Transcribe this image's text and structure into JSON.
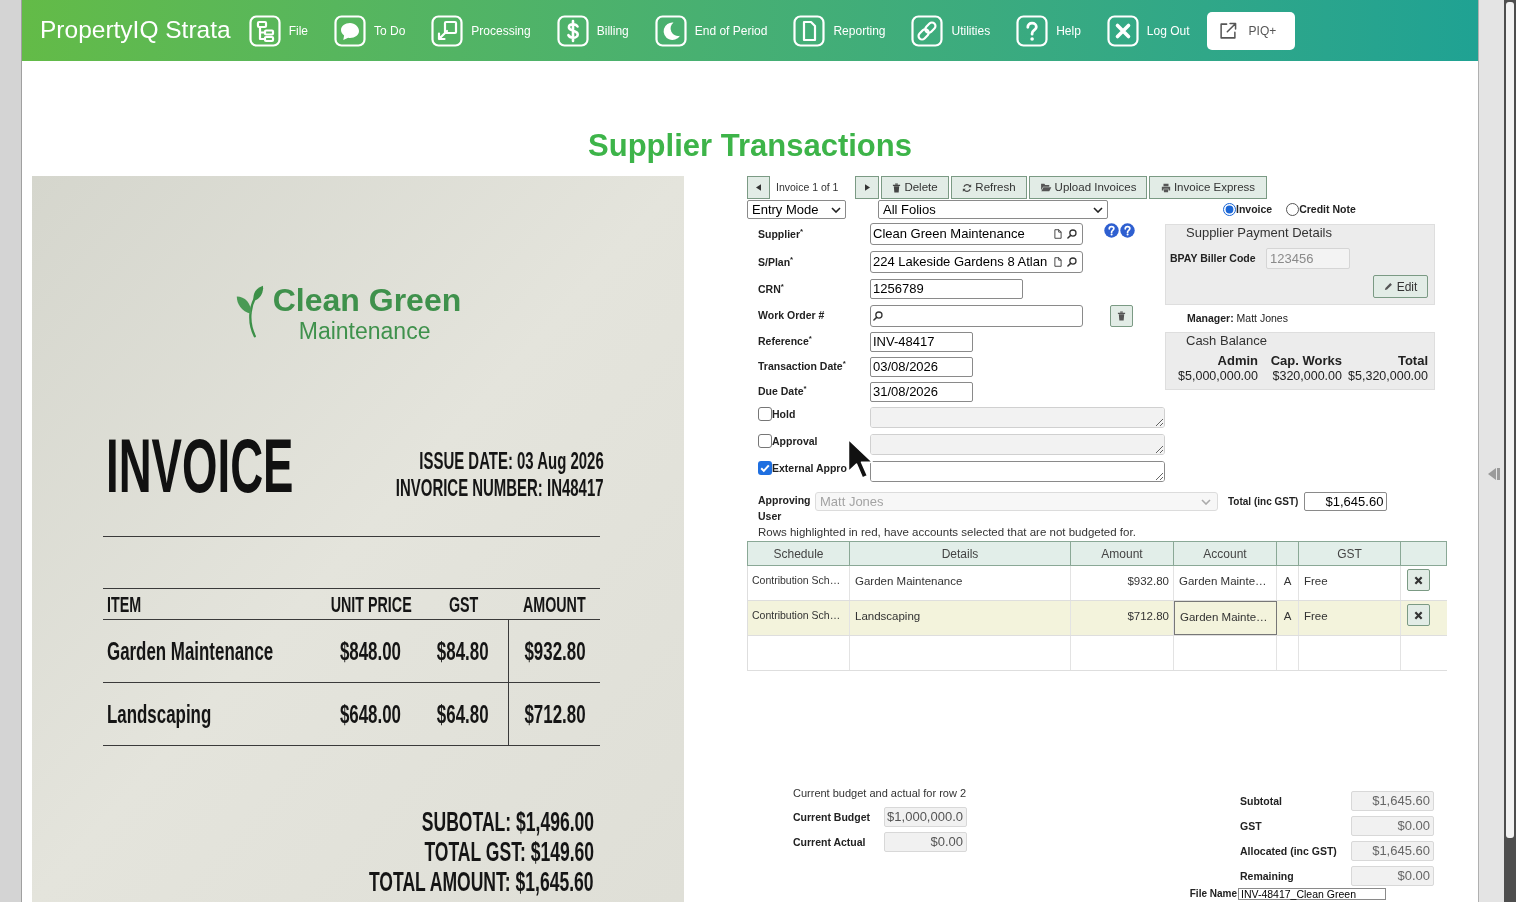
{
  "app_bar": {
    "logo": "PropertyIQ Strata",
    "menu": [
      {
        "label": "File",
        "kind": "file"
      },
      {
        "label": "To Do",
        "kind": "todo"
      },
      {
        "label": "Processing",
        "kind": "processing"
      },
      {
        "label": "Billing",
        "kind": "billing"
      },
      {
        "label": "End of Period",
        "kind": "period"
      },
      {
        "label": "Reporting",
        "kind": "reporting"
      },
      {
        "label": "Utilities",
        "kind": "utilities"
      },
      {
        "label": "Help",
        "kind": "help"
      },
      {
        "label": "Log Out",
        "kind": "logout"
      },
      {
        "label": "PIQ+",
        "kind": "external"
      }
    ]
  },
  "page": {
    "title": "Supplier Transactions"
  },
  "invoice_document": {
    "company": "Clean Green",
    "company_line_2": "Maintenance",
    "heading": "INVOICE",
    "issue_date": "ISSUE DATE: 03 Aug 2026",
    "invoice_number": "INVORICE NUMBER: IN48417",
    "columns": [
      "ITEM",
      "UNIT PRICE",
      "GST",
      "AMOUNT"
    ],
    "rows": [
      [
        "Garden Maintenance",
        "$848.00",
        "$84.80",
        "$932.80"
      ],
      [
        "Landscaping",
        "$648.00",
        "$64.80",
        "$712.80"
      ]
    ],
    "totals": [
      "SUBOTAL: $1,496.00",
      "TOTAL GST: $149.60",
      "TOTAL AMOUNT: $1,645.60"
    ]
  },
  "form": {
    "navigator": {
      "position": "Invoice 1 of 1"
    },
    "toolbar": [
      {
        "label": "Delete",
        "kind": "delete"
      },
      {
        "label": "Refresh",
        "kind": "refresh"
      },
      {
        "label": "Upload Invoices",
        "kind": "upload"
      },
      {
        "label": "Invoice Express",
        "kind": "print"
      }
    ],
    "mode_select": {
      "value": "Entry Mode"
    },
    "folio_select": {
      "value": "All Folios"
    },
    "transaction_type": [
      {
        "label": "Invoice",
        "selected": true
      },
      {
        "label": "Credit Note",
        "selected": false
      }
    ],
    "fields": [
      {
        "label": "Supplier$^{*}$",
        "value": "Clean Green Maintenance",
        "kind": "lookup",
        "help": true
      },
      {
        "label": "S/Plan$^{*}$",
        "value": "224 Lakeside Gardens 8 Atlan",
        "kind": "lookup"
      },
      {
        "label": "CRN$^{*}$",
        "value": "1256789",
        "kind": "number"
      },
      {
        "label": "Work Order #",
        "kind": "search",
        "clear_button": true
      },
      {
        "label": "Reference$^{*}$",
        "value": "INV-48417",
        "kind": "text"
      },
      {
        "label": "Transaction Date$^{*}$",
        "value": "03/08/2026",
        "kind": "date"
      },
      {
        "label": "Due Date$^{*}$",
        "value": "31/08/2026",
        "kind": "date"
      }
    ],
    "payment_details": {
      "legend": "Supplier Payment Details",
      "biller_code_label": "BPAY Biller Code",
      "biller_code": "123456",
      "edit_button": "Edit"
    },
    "manager": "**Manager:** Matt Jones",
    "cash_balance": {
      "legend": "Cash Balance",
      "columns": [
        "Admin",
        "Cap. Works",
        "Total"
      ],
      "values": [
        "$5,000,000.00",
        "$320,000.00",
        "$5,320,000.00"
      ]
    },
    "flags": [
      {
        "label": "Hold",
        "checked": false
      },
      {
        "label": "Approval",
        "checked": false
      },
      {
        "label": "External Appro",
        "checked": true
      }
    ],
    "approving_user": {
      "label": "Approving User",
      "value": "Matt Jones",
      "disabled": true
    },
    "total": {
      "label": "Total (inc GST)",
      "value": "$1,645.60"
    },
    "note": "Rows highlighted in red, have accounts selected that are not budgeted for.",
    "allocations": {
      "columns": [
        "Schedule",
        "Details",
        "Amount",
        "Account",
        "GST"
      ],
      "rows": [
        {
          "schedule": "Contribution Sch…",
          "details": "Garden Maintenance",
          "amount": "$932.80",
          "account": "Garden Mainte…",
          "column_5": "A",
          "gst": "Free",
          "selected": false
        },
        {
          "schedule": "Contribution Sch…",
          "details": "Landscaping",
          "amount": "$712.80",
          "account": "Garden Mainte…",
          "column_5": "A",
          "gst": "Free",
          "selected": true
        }
      ]
    },
    "budget": {
      "caption": "Current budget and actual for row 2",
      "rows": [
        {
          "label": "Current Budget",
          "value": "$1,000,000.0"
        },
        {
          "label": "Current Actual",
          "value": "$0.00"
        }
      ]
    },
    "totals": [
      {
        "label": "Subtotal",
        "value": "$1,645.60"
      },
      {
        "label": "GST",
        "value": "$0.00"
      },
      {
        "label": "Allocated (inc GST)",
        "value": "$1,645.60"
      },
      {
        "label": "Remaining",
        "value": "$0.00"
      }
    ],
    "file_name": {
      "label": "File Name",
      "value": "INV-48417_Clean Green"
    }
  }
}
